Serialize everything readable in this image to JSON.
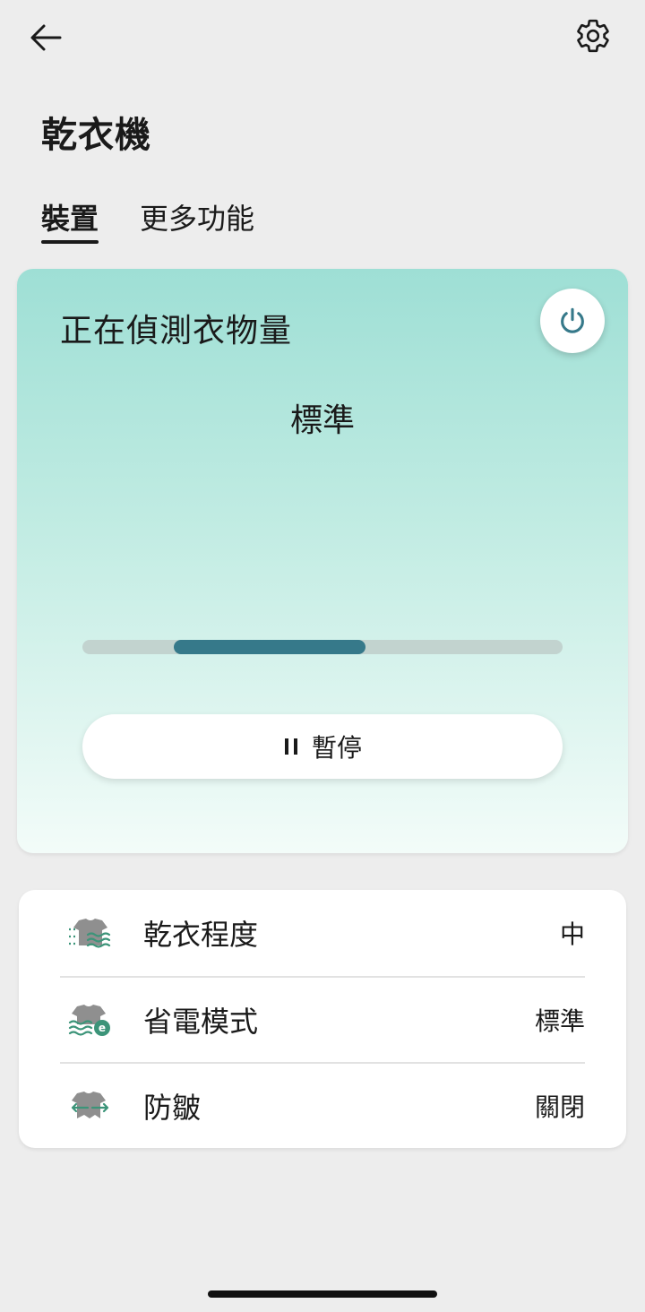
{
  "header": {
    "title": "乾衣機"
  },
  "tabs": [
    {
      "label": "裝置",
      "active": true
    },
    {
      "label": "更多功能",
      "active": false
    }
  ],
  "status": {
    "message": "正在偵測衣物量",
    "course": "標準",
    "progress": {
      "start": 0.19,
      "end": 0.59
    },
    "pause_icon": "pause-icon",
    "pause_label": "暫停"
  },
  "settings": [
    {
      "label": "乾衣程度",
      "value": "中",
      "icon": "drying-level-icon"
    },
    {
      "label": "省電模式",
      "value": "標準",
      "icon": "eco-mode-icon"
    },
    {
      "label": "防皺",
      "value": "關閉",
      "icon": "anti-wrinkle-icon"
    }
  ],
  "colors": {
    "accent": "#36798a",
    "icon_grey": "#8f8f8f",
    "icon_green": "#3c9479",
    "card_top": "#9edfd5",
    "card_bottom": "#f3fcf9"
  }
}
